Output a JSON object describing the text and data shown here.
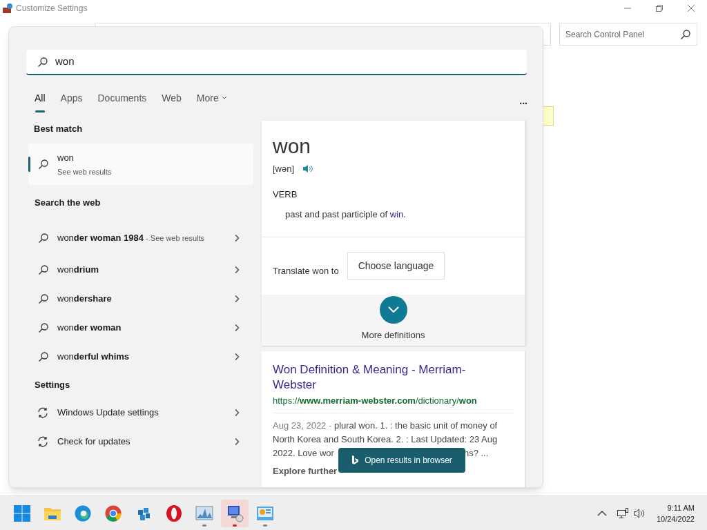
{
  "window": {
    "title": "Customize Settings",
    "search": {
      "placeholder": "Search Control Panel"
    }
  },
  "search_panel": {
    "query": "won",
    "tabs": [
      {
        "label": "All",
        "selected": true
      },
      {
        "label": "Apps",
        "selected": false
      },
      {
        "label": "Documents",
        "selected": false
      },
      {
        "label": "Web",
        "selected": false
      },
      {
        "label": "More",
        "selected": false,
        "kind": "dropdown"
      }
    ],
    "more_menu": "...",
    "best_match": {
      "heading": "Best match",
      "title": "won",
      "subtitle": "See web results",
      "selected": true
    },
    "web": {
      "heading": "Search the web",
      "items": [
        {
          "text": "won**der woman 1984**",
          "suffix": "- See web results"
        },
        {
          "text": "won**drium**"
        },
        {
          "text": "won**dershare**"
        },
        {
          "text": "won**der woman**"
        },
        {
          "text": "won**derful whims**"
        }
      ]
    },
    "settings": {
      "heading": "Settings",
      "items": [
        {
          "text": "Windows Update settings"
        },
        {
          "text": "Check for updates"
        }
      ]
    },
    "dictionary": {
      "word": "won",
      "pronunciation": "[wən]",
      "part_of_speech": "VERB",
      "definition": "past and past participle of",
      "link": "win",
      "definition_end": ".",
      "translate_label": "Translate won to",
      "translate_button": "Choose language",
      "more": "More definitions"
    },
    "result": {
      "title": "Won Definition & Meaning - Merriam-Webster",
      "url": "https://**www.merriam-webster.com**/dictionary/**won**",
      "date": "Aug 23, 2022",
      "lines": [
        "· plural won. 1. : the basic unit of money of",
        "North Korea and South Korea. 2. : Last Updated: 23 Aug"
      ],
      "cut_start": "2022. Love wor",
      "cut_end": "ns? ...",
      "explore": "Explore further"
    },
    "open_browser": "Open results in browser"
  },
  "taskbar": {
    "apps": [
      {
        "kind": "windows",
        "running": false,
        "active": false
      },
      {
        "kind": "folder",
        "running": false,
        "active": false
      },
      {
        "kind": "edge",
        "running": false,
        "active": false
      },
      {
        "kind": "chrome",
        "running": false,
        "active": false
      },
      {
        "kind": "cubes",
        "running": false,
        "active": false
      },
      {
        "kind": "opera",
        "running": false,
        "active": false
      },
      {
        "kind": "monitor",
        "running": true,
        "active": false
      },
      {
        "kind": "computer",
        "running": true,
        "active": true
      },
      {
        "kind": "control",
        "running": true,
        "active": false
      }
    ],
    "time": "9:11 AM",
    "date": "10/24/2022"
  }
}
